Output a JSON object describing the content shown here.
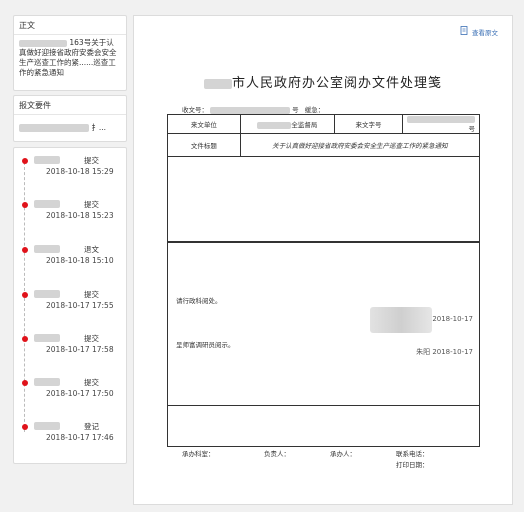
{
  "sidebar": {
    "zhengwen": {
      "title": "正文",
      "text": "163号关于认真做好迎接省政府安委会安全生产巡查工作的紧......巡查工作的紧急通知"
    },
    "baowen": {
      "title": "报文要件",
      "value_suffix": "扌..."
    },
    "timeline": [
      {
        "action": "提交",
        "time": "2018-10-18 15:29"
      },
      {
        "action": "提交",
        "time": "2018-10-18 15:23"
      },
      {
        "action": "退文",
        "time": "2018-10-18 15:10"
      },
      {
        "action": "提交",
        "time": "2018-10-17 17:55"
      },
      {
        "action": "提交",
        "time": "2018-10-17 17:58"
      },
      {
        "action": "提交",
        "time": "2018-10-17 17:50"
      },
      {
        "action": "登记",
        "time": "2018-10-17 17:46"
      }
    ]
  },
  "document": {
    "view_original": "查看原文",
    "title": "市人民政府办公室阅办文件处理笺",
    "receive_no_label": "收文号：",
    "receive_no_suffix": "号",
    "urgency_label": "缓急：",
    "row1": {
      "unit_label": "来文单位",
      "unit_value_suffix": "全监督局",
      "number_label": "来文字号",
      "number_value_suffix": "号"
    },
    "row2": {
      "subject_label": "文件标题",
      "subject_value": "关于认真做好迎接省政府安委会安全生产巡查工作的紧急通知"
    },
    "instruction1": "请行政科阅处。",
    "instruction1_date": "2018-10-17",
    "instruction2": "呈师富调研员阅示。",
    "instruction2_sign": "朱阳 2018-10-17",
    "footer": {
      "office": "承办科室：",
      "leader": "负责人：",
      "handler": "承办人：",
      "phone": "联系电话：",
      "print_date": "打印日期："
    }
  }
}
